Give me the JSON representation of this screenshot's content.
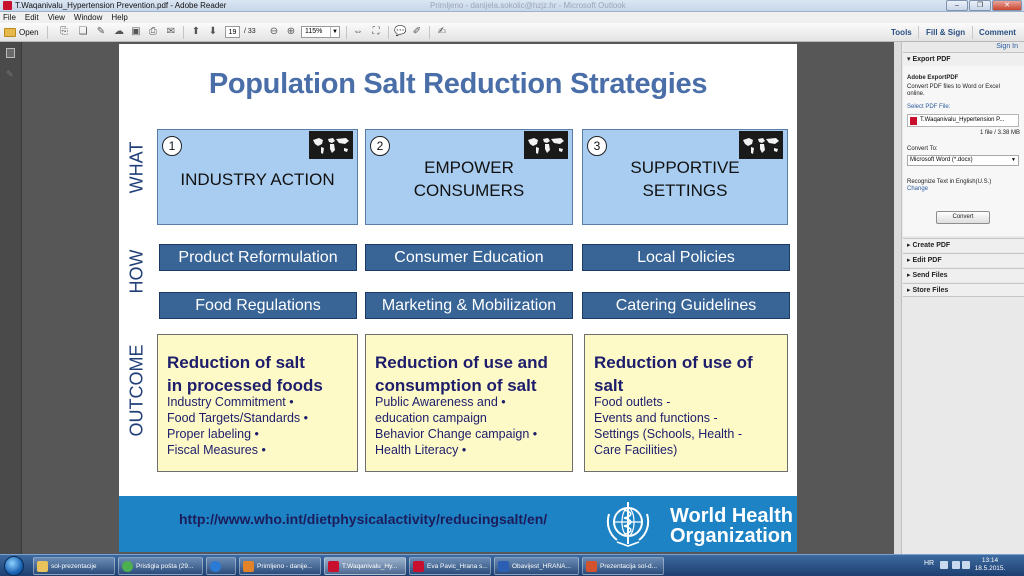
{
  "window": {
    "title": "T.Waqanivalu_Hypertension Prevention.pdf - Adobe Reader",
    "ghost_title": "Primljeno - danijela.sokolic@hzjz.hr - Microsoft Outlook",
    "controls": [
      "–",
      "❐",
      "✕"
    ]
  },
  "menu": [
    "File",
    "Edit",
    "View",
    "Window",
    "Help"
  ],
  "toolbar": {
    "open_label": "Open",
    "page_current": "19",
    "page_total": "/ 33",
    "zoom": "115%",
    "tools_label": "Tools",
    "fill_sign_label": "Fill & Sign",
    "comment_label": "Comment"
  },
  "slide": {
    "title": "Population Salt Reduction Strategies",
    "row_labels": {
      "what": "WHAT",
      "how": "HOW",
      "outcome": "OUTCOME"
    },
    "what": [
      {
        "num": "1",
        "line1": "INDUSTRY ACTION",
        "line2": ""
      },
      {
        "num": "2",
        "line1": "EMPOWER",
        "line2": "CONSUMERS"
      },
      {
        "num": "3",
        "line1": "SUPPORTIVE",
        "line2": "SETTINGS"
      }
    ],
    "how_row1": [
      "Product Reformulation",
      "Consumer Education",
      "Local Policies"
    ],
    "how_row2": [
      "Food Regulations",
      "Marketing & Mobilization",
      "Catering Guidelines"
    ],
    "outcomes": [
      {
        "head1": "Reduction of salt",
        "head2": "in processed foods",
        "items": [
          "Industry Commitment     •",
          "Food Targets/Standards   •",
          "Proper labeling     •",
          "Fiscal Measures     •"
        ]
      },
      {
        "head1": "Reduction of use and",
        "head2": "consumption of  salt",
        "items": [
          "Public Awareness and     •",
          "education campaign",
          "Behavior Change campaign     •",
          "Health Literacy     •"
        ]
      },
      {
        "head1": "Reduction of use of",
        "head2": "salt",
        "items": [
          "Food outlets     -",
          "Events and functions     -",
          "Settings (Schools, Health     -",
          "Care Facilities)"
        ]
      }
    ],
    "footer_link": "http://www.who.int/dietphysicalactivity/reducingsalt/en/",
    "who_line1": "World Health",
    "who_line2": "Organization"
  },
  "right_pane": {
    "sign_in": "Sign In",
    "export_pdf": "Export PDF",
    "adobe_exportpdf": "Adobe ExportPDF",
    "desc_line1": "Convert PDF files to Word or Excel",
    "desc_line2": "online.",
    "select_label": "Select PDF File:",
    "file_name": "T.Waqanivalu_Hypertension P...",
    "file_info": "1 file / 3.38 MB",
    "convert_to": "Convert To:",
    "convert_format": "Microsoft Word (*.docx)",
    "recognize": "Recognize Text in English(U.S.)",
    "change": "Change",
    "convert_button": "Convert",
    "sections": [
      "Create PDF",
      "Edit PDF",
      "Send Files",
      "Store Files"
    ]
  },
  "taskbar": {
    "tasks": [
      {
        "label": "sol-prezentacije",
        "color": "#e8c25a"
      },
      {
        "label": "Pristigla pošta (29...",
        "color": "#4caf50"
      },
      {
        "label": "",
        "color": "#2b7bd6"
      },
      {
        "label": "Primljeno - danije...",
        "color": "#e2832a"
      },
      {
        "label": "T.Waqanivalu_Hy...",
        "color": "#c8102e"
      },
      {
        "label": "Eva Pavic_Hrana s...",
        "color": "#c8102e"
      },
      {
        "label": "Obavijest_HRANA...",
        "color": "#2b5fb3"
      },
      {
        "label": "Prezentacija sol-d...",
        "color": "#d2532d"
      }
    ],
    "lang": "HR",
    "time": "13:14",
    "date": "18.5.2015."
  }
}
